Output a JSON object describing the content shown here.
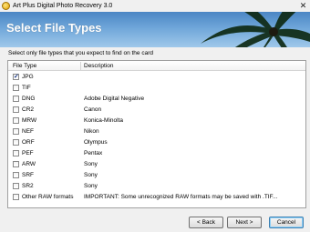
{
  "window": {
    "title": "Art Plus Digital Photo Recovery 3.0"
  },
  "banner": {
    "title": "Select File Types"
  },
  "instruction": "Select only file types that you expect to find on the card",
  "list": {
    "columns": {
      "type": "File Type",
      "description": "Description"
    },
    "rows": [
      {
        "type": "JPG",
        "description": "",
        "checked": true
      },
      {
        "type": "TIF",
        "description": "",
        "checked": false
      },
      {
        "type": "DNG",
        "description": "Adobe Digital Negative",
        "checked": false
      },
      {
        "type": "CR2",
        "description": "Canon",
        "checked": false
      },
      {
        "type": "MRW",
        "description": "Konica-Minolta",
        "checked": false
      },
      {
        "type": "NEF",
        "description": "Nikon",
        "checked": false
      },
      {
        "type": "ORF",
        "description": "Olympus",
        "checked": false
      },
      {
        "type": "PEF",
        "description": "Pentax",
        "checked": false
      },
      {
        "type": "ARW",
        "description": "Sony",
        "checked": false
      },
      {
        "type": "SRF",
        "description": "Sony",
        "checked": false
      },
      {
        "type": "SR2",
        "description": "Sony",
        "checked": false
      },
      {
        "type": "Other RAW formats",
        "description": "IMPORTANT: Some unrecognized RAW formats may be saved with .TIF...",
        "checked": false
      }
    ]
  },
  "buttons": {
    "back": "< Back",
    "next": "Next >",
    "cancel": "Cancel"
  },
  "colors": {
    "banner_top": "#4b86c4",
    "banner_bottom": "#9fc8ea",
    "check": "#1a3a8a"
  }
}
